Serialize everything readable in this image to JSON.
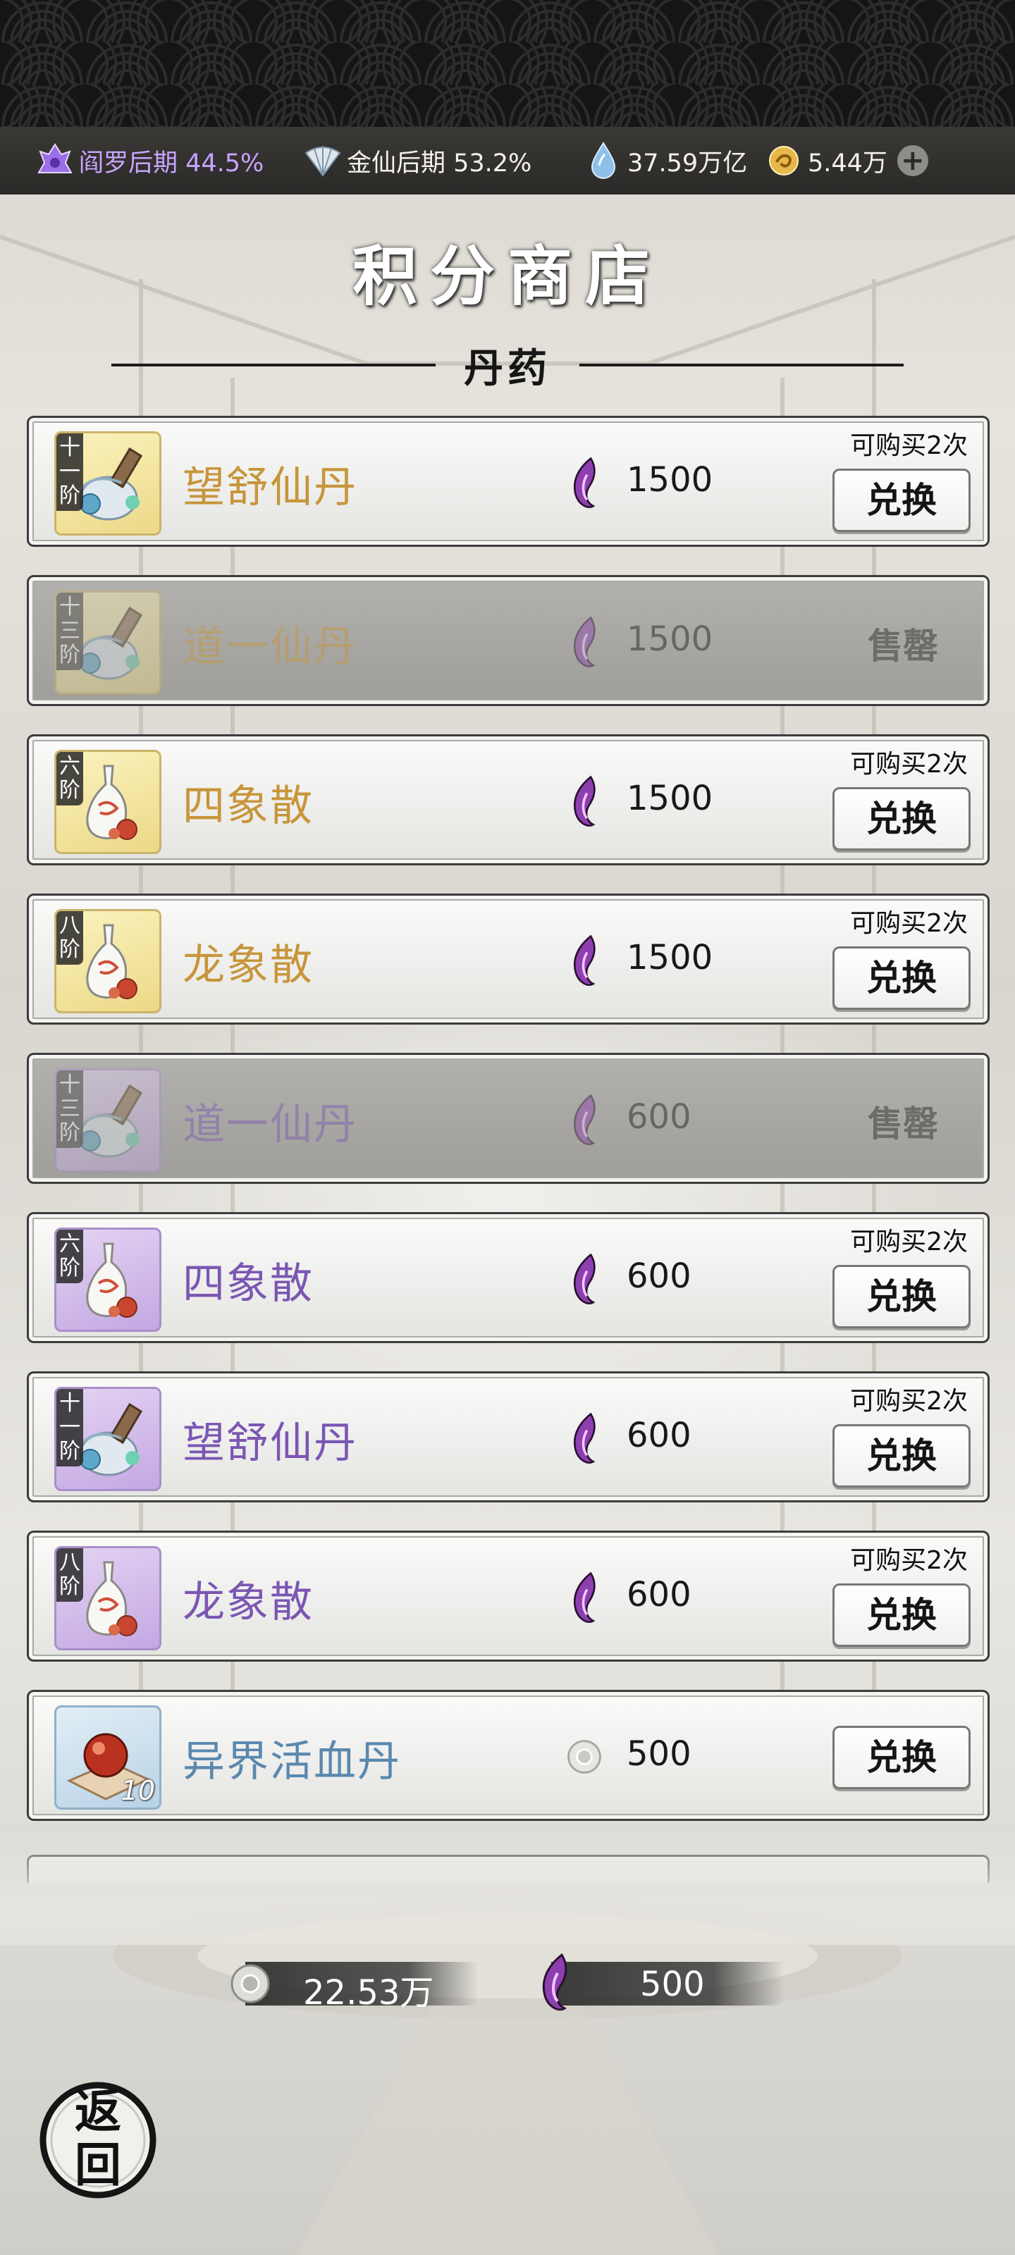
{
  "topbar": {
    "stats": [
      {
        "icon": "purple-realm-icon",
        "text": "阎罗后期 44.5%",
        "color": "#c8a4ff"
      },
      {
        "icon": "fan-icon",
        "text": "金仙后期 53.2%",
        "color": "#f3f1ea"
      },
      {
        "icon": "spirit-stone-icon",
        "text": "37.59万亿",
        "color": "#f3f1ea"
      },
      {
        "icon": "gold-coin-icon",
        "text": "5.44万",
        "color": "#f3f1ea"
      }
    ],
    "plus_label": "+"
  },
  "page_title": "积分商店",
  "section_title": "丹药",
  "items": [
    {
      "tier": "十一阶",
      "name": "望舒仙丹",
      "rarity": "gold",
      "price": "1500",
      "coin": "purple-flame-icon",
      "limit": "可购买2次",
      "action": "兑换",
      "sold_out": false,
      "item_icon": "dragon-vase-icon"
    },
    {
      "tier": "十三阶",
      "name": "道一仙丹",
      "rarity": "gold",
      "price": "1500",
      "coin": "purple-flame-icon",
      "limit": "",
      "action": "售罄",
      "sold_out": true,
      "item_icon": "dragon-vase-icon"
    },
    {
      "tier": "六阶",
      "name": "四象散",
      "rarity": "gold",
      "price": "1500",
      "coin": "purple-flame-icon",
      "limit": "可购买2次",
      "action": "兑换",
      "sold_out": false,
      "item_icon": "white-vase-icon"
    },
    {
      "tier": "八阶",
      "name": "龙象散",
      "rarity": "gold",
      "price": "1500",
      "coin": "purple-flame-icon",
      "limit": "可购买2次",
      "action": "兑换",
      "sold_out": false,
      "item_icon": "white-vase-icon"
    },
    {
      "tier": "十三阶",
      "name": "道一仙丹",
      "rarity": "purple",
      "price": "600",
      "coin": "purple-flame-icon",
      "limit": "",
      "action": "售罄",
      "sold_out": true,
      "item_icon": "dragon-vase-icon"
    },
    {
      "tier": "六阶",
      "name": "四象散",
      "rarity": "purple",
      "price": "600",
      "coin": "purple-flame-icon",
      "limit": "可购买2次",
      "action": "兑换",
      "sold_out": false,
      "item_icon": "white-vase-icon"
    },
    {
      "tier": "十一阶",
      "name": "望舒仙丹",
      "rarity": "purple",
      "price": "600",
      "coin": "purple-flame-icon",
      "limit": "可购买2次",
      "action": "兑换",
      "sold_out": false,
      "item_icon": "dragon-vase-icon"
    },
    {
      "tier": "八阶",
      "name": "龙象散",
      "rarity": "purple",
      "price": "600",
      "coin": "purple-flame-icon",
      "limit": "可购买2次",
      "action": "兑换",
      "sold_out": false,
      "item_icon": "white-vase-icon"
    },
    {
      "tier": "",
      "name": "异界活血丹",
      "rarity": "blue",
      "price": "500",
      "coin": "silver-coin-icon",
      "limit": "",
      "action": "兑换",
      "sold_out": false,
      "item_icon": "red-pill-icon",
      "count": "10"
    }
  ],
  "currencies": [
    {
      "icon": "silver-coin-icon",
      "value": "22.53万"
    },
    {
      "icon": "purple-flame-icon",
      "value": "500"
    }
  ],
  "back_label": "返回",
  "colors": {
    "gold_name": "#c7953a",
    "purple_name": "#7b56b3",
    "blue_name": "#5a88ae",
    "topbar_bg": "#2b2a28"
  }
}
